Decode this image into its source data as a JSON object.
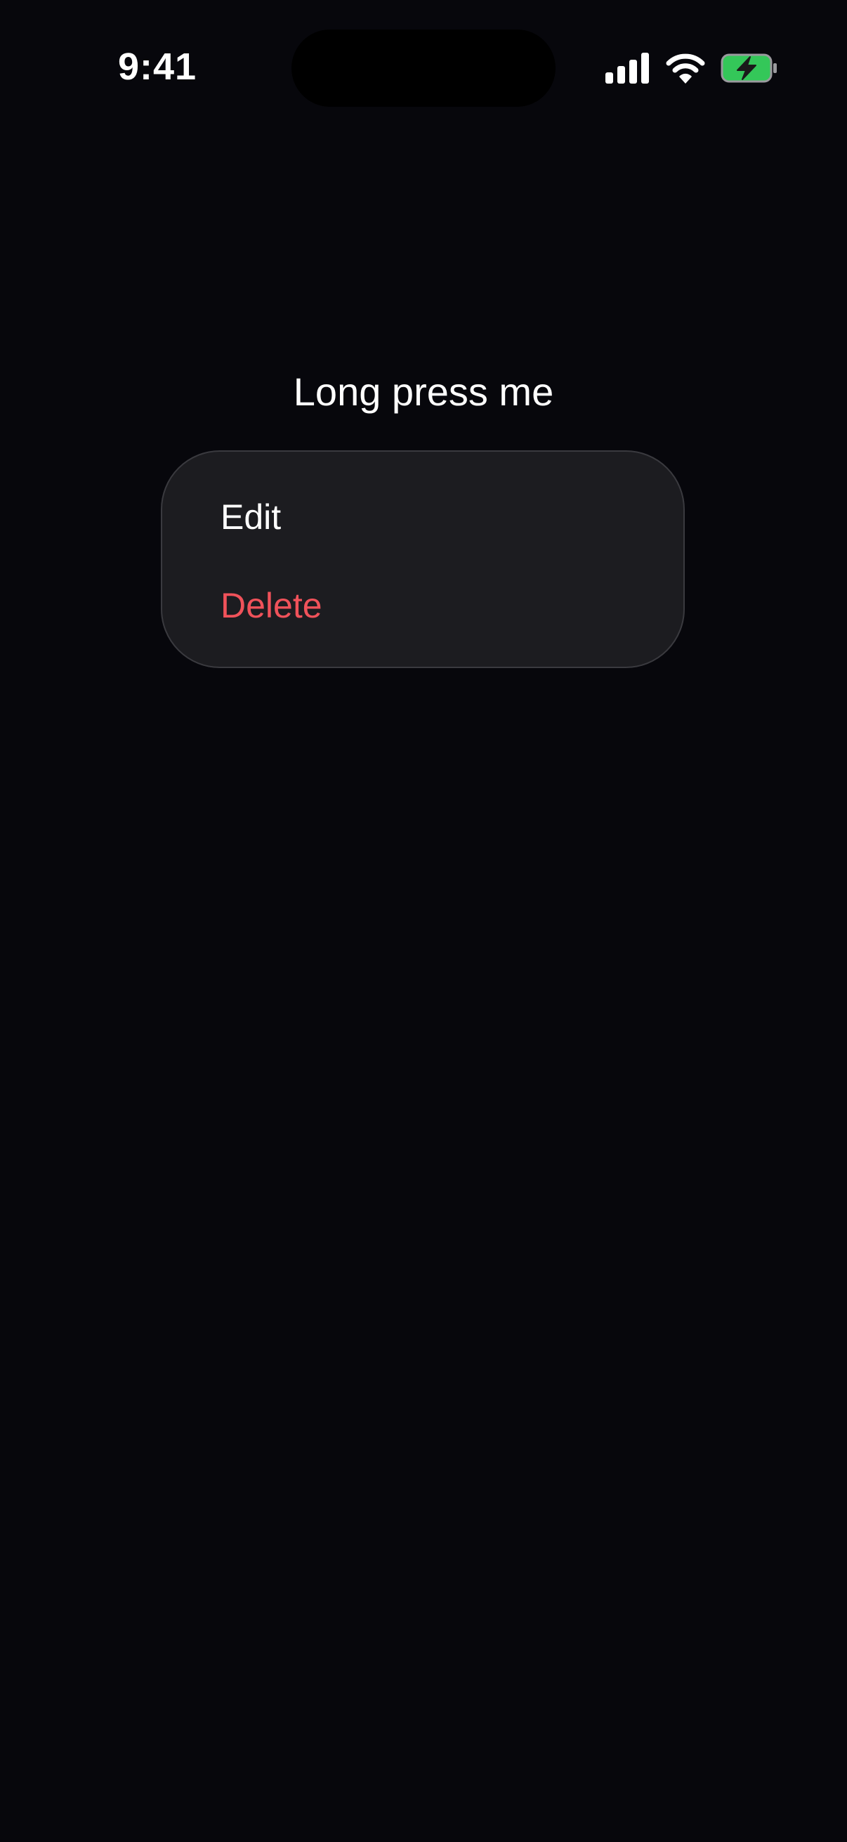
{
  "status_bar": {
    "time": "9:41",
    "icons": [
      "signal-icon",
      "wifi-icon",
      "battery-charging-icon"
    ],
    "battery_color": "#34c759"
  },
  "main": {
    "label": "Long press me"
  },
  "context_menu": {
    "items": [
      {
        "label": "Edit",
        "color": "#ffffff"
      },
      {
        "label": "Delete",
        "color": "#f0525a"
      }
    ]
  }
}
